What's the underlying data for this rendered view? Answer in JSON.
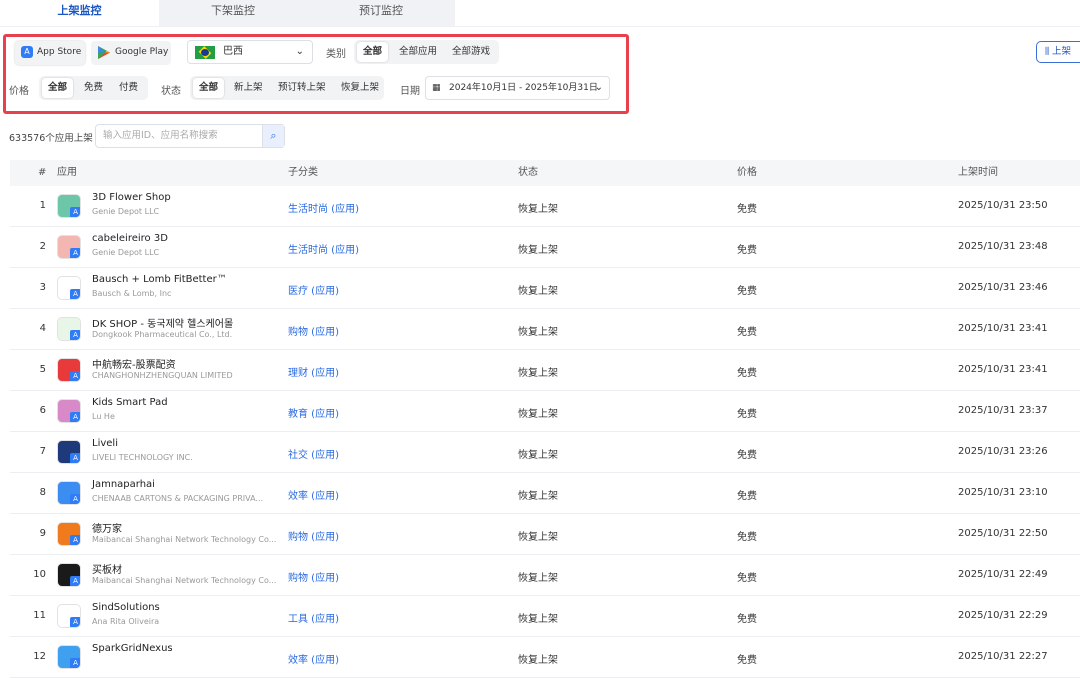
{
  "tabs": [
    {
      "label": "上架监控"
    },
    {
      "label": "下架监控"
    },
    {
      "label": "预订监控"
    }
  ],
  "filters": {
    "store_appstore": "App Store",
    "store_google": "Google Play",
    "country": "巴西",
    "category_label": "类别",
    "category_options": [
      "全部",
      "全部应用",
      "全部游戏"
    ],
    "price_label": "价格",
    "price_options": [
      "全部",
      "免费",
      "付费"
    ],
    "status_label": "状态",
    "status_options": [
      "全部",
      "新上架",
      "预订转上架",
      "恢复上架"
    ],
    "date_label": "日期",
    "date_range": "2024年10月1日 - 2025年10月31日"
  },
  "right_button": "上架",
  "count_text": "633576个应用上架",
  "search": {
    "placeholder": "输入应用ID、应用名称搜索"
  },
  "table": {
    "headers": [
      "#",
      "应用",
      "子分类",
      "状态",
      "价格",
      "上架时间"
    ],
    "rows": [
      {
        "idx": "1",
        "name": "3D Flower Shop",
        "dev": "Genie Depot LLC",
        "sub": "生活时尚 (应用)",
        "status": "恢复上架",
        "price": "免费",
        "time": "2025/10/31 23:50",
        "icon": "flower-shop-icon",
        "color": "#6cc7a8"
      },
      {
        "idx": "2",
        "name": "cabeleireiro 3D",
        "dev": "Genie Depot LLC",
        "sub": "生活时尚 (应用)",
        "status": "恢复上架",
        "price": "免费",
        "time": "2025/10/31 23:48",
        "icon": "hairdresser-icon",
        "color": "#f3b6b0"
      },
      {
        "idx": "3",
        "name": "Bausch + Lomb FitBetter™",
        "dev": "Bausch & Lomb, Inc",
        "sub": "医疗 (应用)",
        "status": "恢复上架",
        "price": "免费",
        "time": "2025/10/31 23:46",
        "icon": "bl-icon",
        "color": "#ffffff"
      },
      {
        "idx": "4",
        "name": "DK SHOP - 동국제약 헬스케어몰",
        "dev": "Dongkook Pharmaceutical Co., Ltd.",
        "sub": "购物 (应用)",
        "status": "恢复上架",
        "price": "免费",
        "time": "2025/10/31 23:41",
        "icon": "dk-icon",
        "color": "#e8f6e8"
      },
      {
        "idx": "5",
        "name": "中航畅宏-股票配资",
        "dev": "CHANGHONHZHENGQUAN LIMITED",
        "sub": "理财 (应用)",
        "status": "恢复上架",
        "price": "免费",
        "time": "2025/10/31 23:41",
        "icon": "changhong-icon",
        "color": "#e8393b"
      },
      {
        "idx": "6",
        "name": "Kids Smart Pad",
        "dev": "Lu He",
        "sub": "教育 (应用)",
        "status": "恢复上架",
        "price": "免费",
        "time": "2025/10/31 23:37",
        "icon": "kids-pad-icon",
        "color": "#d88ac8"
      },
      {
        "idx": "7",
        "name": "Liveli",
        "dev": "LIVELI TECHNOLOGY INC.",
        "sub": "社交 (应用)",
        "status": "恢复上架",
        "price": "免费",
        "time": "2025/10/31 23:26",
        "icon": "liveli-icon",
        "color": "#1f3a7a"
      },
      {
        "idx": "8",
        "name": "Jamnaparhai",
        "dev": "CHENAAB CARTONS & PACKAGING PRIVA...",
        "sub": "效率 (应用)",
        "status": "恢复上架",
        "price": "免费",
        "time": "2025/10/31 23:10",
        "icon": "cloud-icon",
        "color": "#3b8df2"
      },
      {
        "idx": "9",
        "name": "德万家",
        "dev": "Maibancai Shanghai Network Technology Co...",
        "sub": "购物 (应用)",
        "status": "恢复上架",
        "price": "免费",
        "time": "2025/10/31 22:50",
        "icon": "dewanjia-icon",
        "color": "#f07a1e"
      },
      {
        "idx": "10",
        "name": "买板材",
        "dev": "Maibancai Shanghai Network Technology Co...",
        "sub": "购物 (应用)",
        "status": "恢复上架",
        "price": "免费",
        "time": "2025/10/31 22:49",
        "icon": "maibancai-icon",
        "color": "#1a1a1a"
      },
      {
        "idx": "11",
        "name": "SindSolutions",
        "dev": "Ana Rita Oliveira",
        "sub": "工具 (应用)",
        "status": "恢复上架",
        "price": "免费",
        "time": "2025/10/31 22:29",
        "icon": "sind-icon",
        "color": "#ffffff"
      },
      {
        "idx": "12",
        "name": "SparkGridNexus",
        "dev": "",
        "sub": "效率 (应用)",
        "status": "恢复上架",
        "price": "免费",
        "time": "2025/10/31 22:27",
        "icon": "spark-icon",
        "color": "#3fa0f0"
      }
    ]
  }
}
